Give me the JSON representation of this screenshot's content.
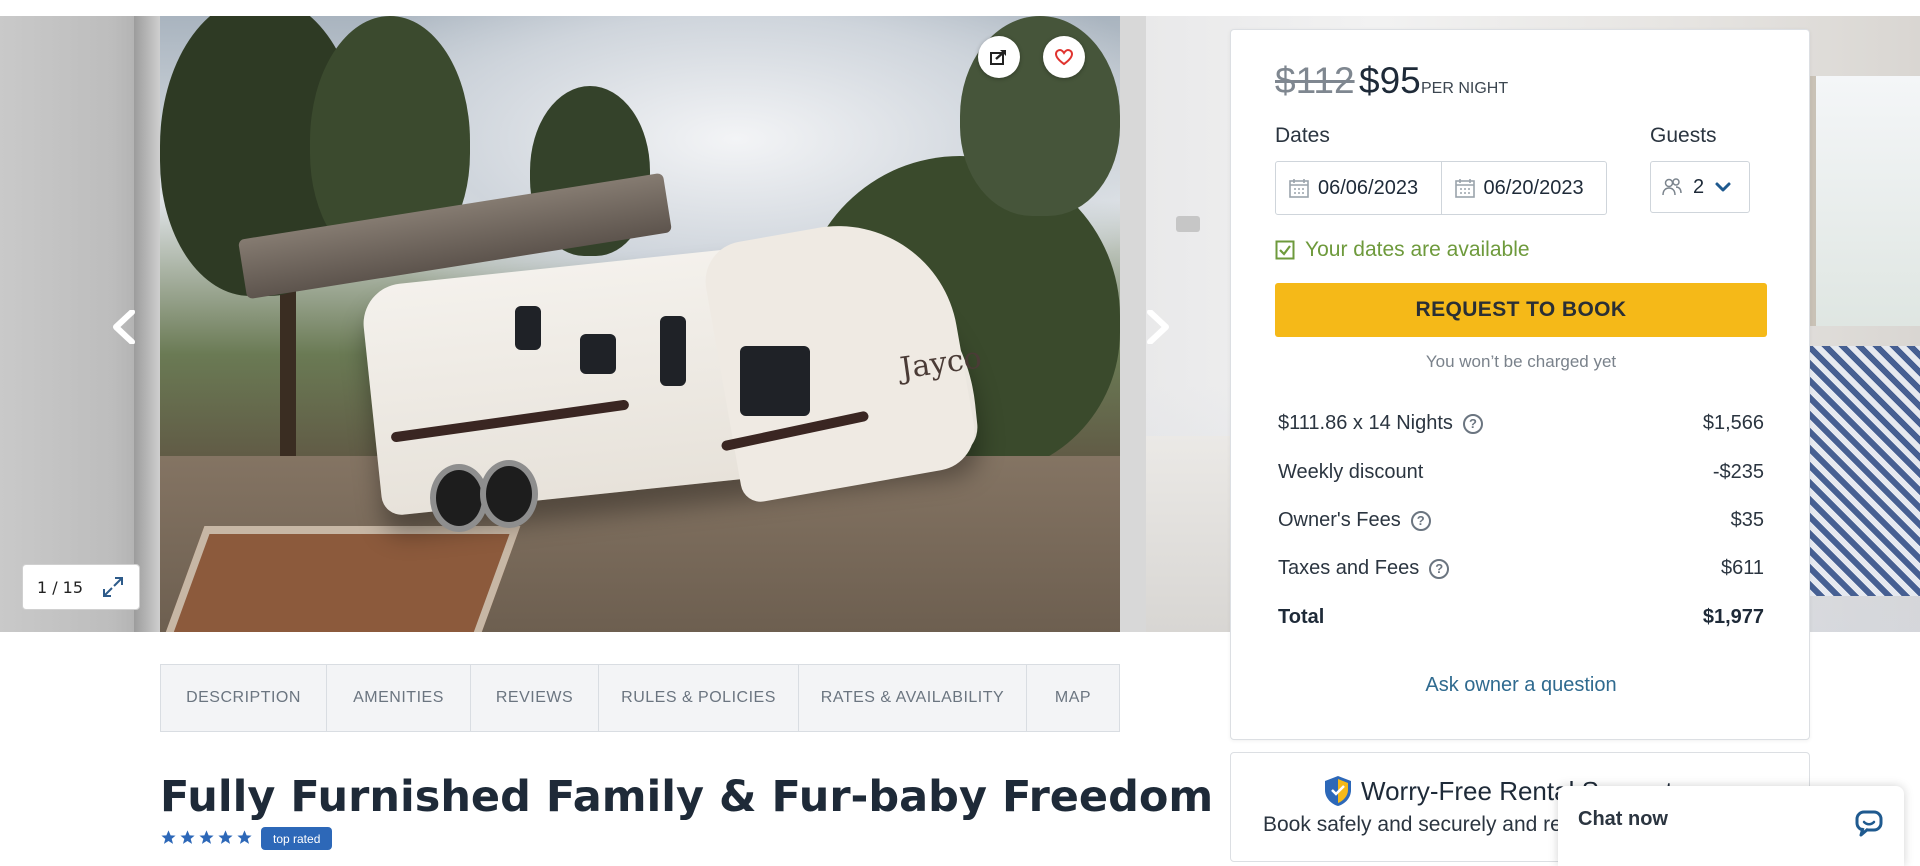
{
  "gallery": {
    "counter": "1 / 15",
    "photo_text": "Jayco"
  },
  "tabs": [
    "DESCRIPTION",
    "AMENITIES",
    "REVIEWS",
    "RULES & POLICIES",
    "RATES & AVAILABILITY",
    "MAP"
  ],
  "listing": {
    "title": "Fully Furnished Family & Fur-baby Freedom RV",
    "rating_stars": 5,
    "badge": "top rated"
  },
  "booking": {
    "price_old": "$112",
    "price_new": "$95",
    "per_night": "PER NIGHT",
    "dates_label": "Dates",
    "guests_label": "Guests",
    "check_in": "06/06/2023",
    "check_out": "06/20/2023",
    "guests_value": "2",
    "availability": "Your dates are available",
    "request_button": "REQUEST TO BOOK",
    "charge_note": "You won’t be charged yet",
    "lines": [
      {
        "label": "$111.86 x 14 Nights",
        "amount": "$1,566",
        "help": true
      },
      {
        "label": "Weekly discount",
        "amount": "-$235",
        "help": false
      },
      {
        "label": "Owner's Fees",
        "amount": "$35",
        "help": true
      },
      {
        "label": "Taxes and Fees",
        "amount": "$611",
        "help": true
      },
      {
        "label": "Total",
        "amount": "$1,977",
        "help": false
      }
    ],
    "ask_owner": "Ask owner a question"
  },
  "worry_free": {
    "title": "Worry-Free Rental Support",
    "subtitle": "Book safely and securely and rent with confidence"
  },
  "chat": {
    "label": "Chat now"
  },
  "colors": {
    "accent_yellow": "#f5b918",
    "available_green": "#6e9a3c",
    "link_blue": "#2f6a8f",
    "badge_blue": "#2d68b8",
    "star_blue": "#2d68b8"
  }
}
